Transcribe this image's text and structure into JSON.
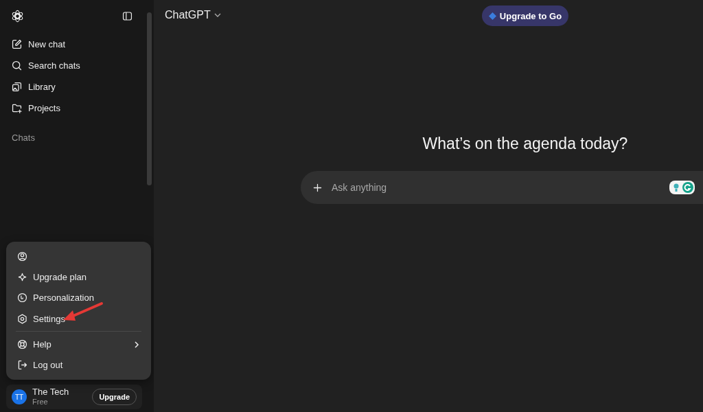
{
  "sidebar": {
    "nav": [
      {
        "kind": "new",
        "label": "New chat"
      },
      {
        "kind": "search",
        "label": "Search chats"
      },
      {
        "kind": "library",
        "label": "Library"
      },
      {
        "kind": "projects",
        "label": "Projects"
      }
    ],
    "section_label": "Chats",
    "user": {
      "initials": "TT",
      "name": "The Tech",
      "plan": "Free",
      "button": "Upgrade"
    }
  },
  "account_menu": {
    "items": [
      {
        "kind": "account",
        "submenu": false
      },
      {
        "kind": "upgrade",
        "label": "Upgrade plan",
        "submenu": false
      },
      {
        "kind": "personalization",
        "label": "Personalization",
        "submenu": false
      },
      {
        "kind": "settings",
        "label": "Settings",
        "submenu": false
      },
      {
        "kind": "divider"
      },
      {
        "kind": "help",
        "label": "Help",
        "submenu": true
      },
      {
        "kind": "logout",
        "label": "Log out",
        "submenu": false
      }
    ]
  },
  "header": {
    "model": "ChatGPT",
    "upgrade_button": "Upgrade to Go"
  },
  "heading": "What’s on the agenda today?",
  "composer": {
    "placeholder": "Ask anything"
  }
}
